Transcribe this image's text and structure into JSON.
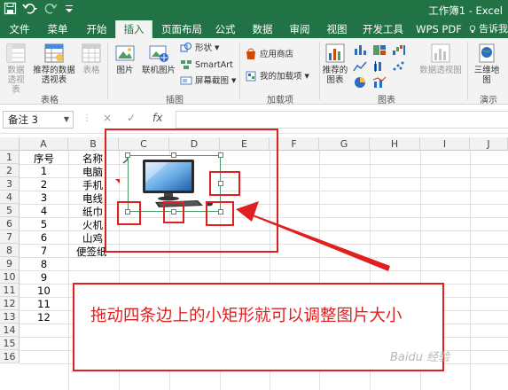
{
  "window": {
    "title": "工作簿1 - Excel"
  },
  "menu": {
    "tabs": [
      {
        "label": "文件"
      },
      {
        "label": "菜单"
      },
      {
        "label": "开始"
      },
      {
        "label": "插入"
      },
      {
        "label": "页面布局"
      },
      {
        "label": "公式"
      },
      {
        "label": "数据"
      },
      {
        "label": "审阅"
      },
      {
        "label": "视图"
      },
      {
        "label": "开发工具"
      },
      {
        "label": "WPS PDF"
      }
    ],
    "active_tab": "插入",
    "tell_me": "告诉我"
  },
  "ribbon": {
    "pivot": "数据透视表",
    "recommended_pivot": "推荐的数据透视表",
    "table": "表格",
    "group_tables": "表格",
    "picture": "图片",
    "online_picture": "联机图片",
    "shapes": "形状",
    "smartart": "SmartArt",
    "screenshot": "屏幕截图",
    "group_illustrations": "插图",
    "app_store": "应用商店",
    "my_addins": "我的加载项",
    "group_addins": "加载项",
    "recommended_charts": "推荐的图表",
    "pivot_chart": "数据透视图",
    "group_charts": "图表",
    "map3d": "三维地图",
    "group_tours": "演示"
  },
  "formula_bar": {
    "name_box": "备注 3",
    "cancel": "×",
    "enter": "✓",
    "fx": "fx",
    "value": ""
  },
  "sheet": {
    "columns": [
      "A",
      "B",
      "C",
      "D",
      "E",
      "F",
      "G",
      "H",
      "I",
      "J"
    ],
    "rows": [
      "1",
      "2",
      "3",
      "4",
      "5",
      "6",
      "7",
      "8",
      "9",
      "10",
      "11",
      "12",
      "13",
      "14",
      "15",
      "16"
    ],
    "col_a": [
      "序号",
      "1",
      "2",
      "3",
      "4",
      "5",
      "6",
      "7",
      "8",
      "9",
      "10",
      "11",
      "12"
    ],
    "col_b": [
      "名称",
      "电脑",
      "手机",
      "电线",
      "纸巾",
      "火机",
      "山鸡",
      "便签纸"
    ]
  },
  "annotation": {
    "callout": "拖动四条边上的小矩形就可以调整图片大小",
    "watermark": "Baidu 经验"
  }
}
